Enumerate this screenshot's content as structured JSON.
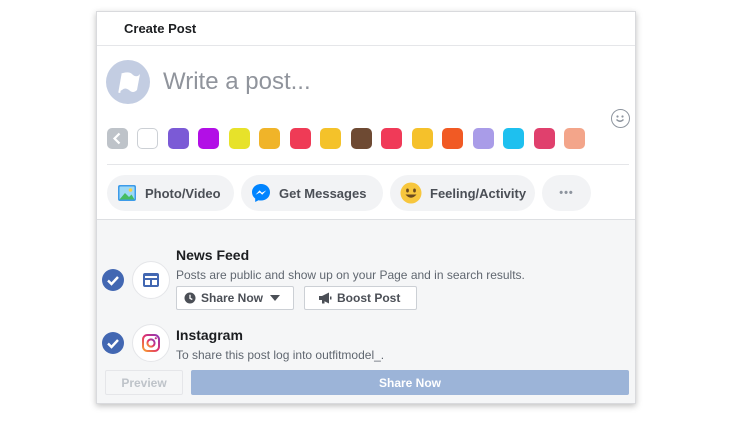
{
  "header": {
    "title": "Create Post"
  },
  "composer": {
    "placeholder": "Write a post..."
  },
  "backgrounds": {
    "colors": [
      "#ffffff",
      "#7b5ad6",
      "#b20fe6",
      "#e7e22a",
      "#f0b429",
      "#ef3b56",
      "#f4c22a",
      "#6e4a33",
      "#f03a58",
      "#f5c12b",
      "#f15a24",
      "#a99ce8",
      "#1ec0ef",
      "#e0406d",
      "#f3a58a"
    ]
  },
  "actions": {
    "photo_video": "Photo/Video",
    "get_messages": "Get Messages",
    "feeling_activity": "Feeling/Activity",
    "more": "•••"
  },
  "news_feed": {
    "title": "News Feed",
    "description": "Posts are public and show up on your Page and in search results.",
    "share_now_label": "Share Now",
    "boost_post_label": "Boost Post"
  },
  "instagram": {
    "title": "Instagram",
    "description": "To share this post log into outfitmodel_."
  },
  "footer": {
    "preview_label": "Preview",
    "share_now_label": "Share Now"
  },
  "colors": {
    "accent": "#4267b2",
    "share_button_disabled": "#9cb4d8"
  }
}
